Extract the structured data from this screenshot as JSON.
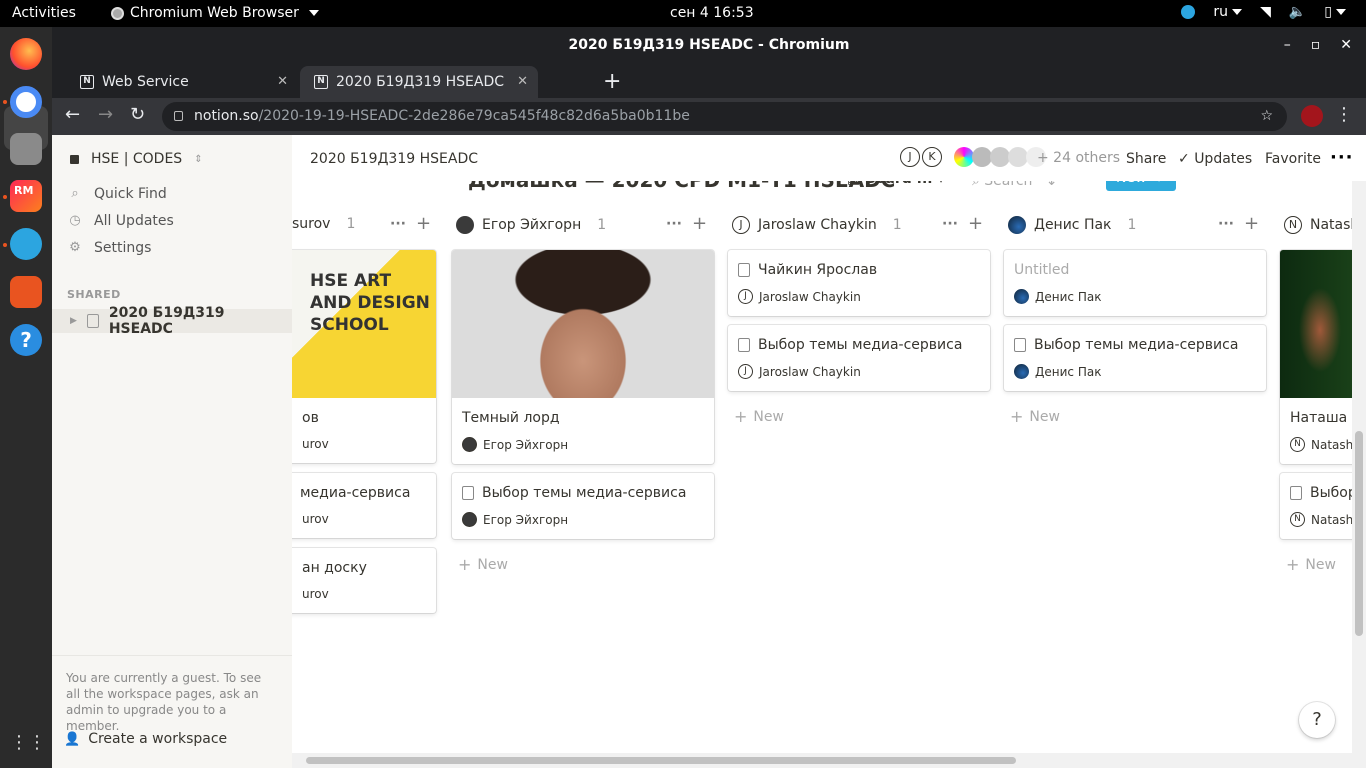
{
  "os": {
    "activities": "Activities",
    "app_name": "Chromium Web Browser",
    "clock": "сен 4  16:53",
    "lang": "ru"
  },
  "browser": {
    "window_title": "2020 Б19Д319 HSEADC - Chromium",
    "tabs": [
      {
        "label": "Web Service",
        "favicon": "N"
      },
      {
        "label": "2020 Б19Д319 HSEADC",
        "favicon": "N"
      }
    ],
    "url_host": "notion.so",
    "url_path": "/2020-19-19-HSEADC-2de286e79ca545f48c82d6a5ba0b11be"
  },
  "sidebar": {
    "workspace": "HSE | CODES",
    "items": [
      "Quick Find",
      "All Updates",
      "Settings"
    ],
    "shared_label": "SHARED",
    "page": "2020 Б19Д319 HSEADC",
    "guest_note": "You are currently a guest. To see all the workspace pages, ask an admin to upgrade you to a member.",
    "create_workspace": "Create a workspace"
  },
  "header": {
    "breadcrumb": "2020 Б19Д319 HSEADC",
    "faces": [
      "J",
      "K"
    ],
    "others": "+ 24 others",
    "share": "Share",
    "updates": "Updates",
    "favorite": "Favorite"
  },
  "database": {
    "title": "Домашка — 2020 СРD М1-Т1 HSEADC",
    "view": "Board ...",
    "search": "Search",
    "new": "New",
    "add_new": "New",
    "columns": [
      {
        "name": "surov",
        "count": "1",
        "cards": [
          "ов",
          "медиа-сервиса",
          "ан доску"
        ],
        "person": "urov"
      },
      {
        "name": "Егор Эйхгорн",
        "count": "1",
        "cards": [
          "Темный лорд",
          "Выбор темы медиа-сервиса"
        ],
        "person": "Егор Эйхгорн"
      },
      {
        "name": "Jaroslaw Chaykin",
        "count": "1",
        "cards": [
          "Чайкин Ярослав",
          "Выбор темы медиа-сервиса"
        ],
        "person": "Jaroslaw Chaykin"
      },
      {
        "name": "Денис Пак",
        "count": "1",
        "cards": [
          "Untitled",
          "Выбор темы медиа-сервиса"
        ],
        "person": "Денис Пак"
      },
      {
        "name": "Natash",
        "count": "",
        "cards": [
          "Наташа К",
          "Выбор"
        ],
        "person": "Natasha"
      }
    ],
    "cover_text": "HSE ART AND DESIGN SCHOOL"
  },
  "help": "?"
}
